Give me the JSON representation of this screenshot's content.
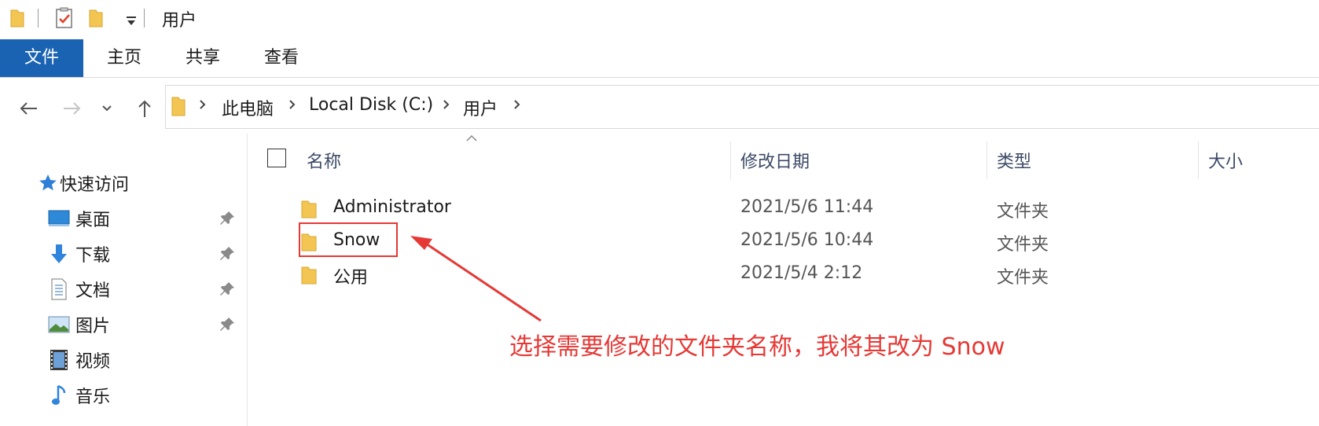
{
  "window": {
    "title": "用户"
  },
  "ribbon": {
    "tabs": [
      "文件",
      "主页",
      "共享",
      "查看"
    ],
    "active_tab": "文件"
  },
  "breadcrumb": [
    "此电脑",
    "Local Disk (C:)",
    "用户"
  ],
  "quick_access": {
    "label": "快速访问",
    "items": [
      {
        "label": "桌面",
        "icon": "desktop-icon",
        "pinned": true
      },
      {
        "label": "下载",
        "icon": "download-icon",
        "pinned": true
      },
      {
        "label": "文档",
        "icon": "document-icon",
        "pinned": true
      },
      {
        "label": "图片",
        "icon": "pictures-icon",
        "pinned": true
      },
      {
        "label": "视频",
        "icon": "video-icon",
        "pinned": false
      },
      {
        "label": "音乐",
        "icon": "music-icon",
        "pinned": false
      }
    ]
  },
  "columns": {
    "name": "名称",
    "modified": "修改日期",
    "type": "类型",
    "size": "大小"
  },
  "files": [
    {
      "name": "Administrator",
      "modified": "2021/5/6 11:44",
      "type": "文件夹"
    },
    {
      "name": "Snow",
      "modified": "2021/5/6 10:44",
      "type": "文件夹"
    },
    {
      "name": "公用",
      "modified": "2021/5/4 2:12",
      "type": "文件夹"
    }
  ],
  "annotation": {
    "text": "选择需要修改的文件夹名称，我将其改为 Snow",
    "color": "#e53935"
  },
  "colors": {
    "accent": "#1a63b2",
    "folder": "#f3c654"
  }
}
